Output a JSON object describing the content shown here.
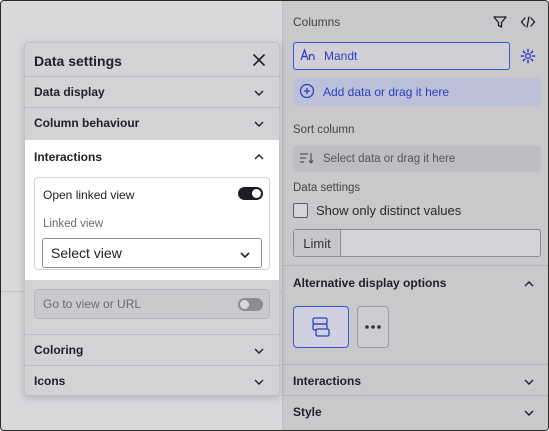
{
  "right_panel": {
    "columns_label": "Columns",
    "column_chip": "Mandt",
    "add_data": "Add data or drag it here",
    "sort_column_label": "Sort column",
    "sort_placeholder": "Select data or drag it here",
    "data_settings_label": "Data settings",
    "distinct_label": "Show only distinct values",
    "limit_label": "Limit",
    "limit_value": "",
    "alt_display_title": "Alternative display options",
    "interactions_title": "Interactions",
    "style_title": "Style"
  },
  "popup": {
    "title": "Data settings",
    "sections": {
      "data_display": "Data display",
      "column_behaviour": "Column behaviour",
      "interactions": "Interactions",
      "coloring": "Coloring",
      "icons": "Icons"
    },
    "open_linked_view": "Open linked view",
    "open_linked_view_on": true,
    "linked_view_label": "Linked view",
    "select_value": "Select view",
    "goto_label": "Go to view or URL",
    "goto_on": false
  },
  "icons": {
    "filter": "filter-icon",
    "code": "code-icon",
    "text_type": "text-type-icon",
    "gear": "gear-icon",
    "add": "plus-circle-icon",
    "sort": "sort-icon",
    "close": "close-icon",
    "chevron_down": "chevron-down-icon",
    "chevron_up": "chevron-up-icon"
  },
  "colors": {
    "accent": "#3b53d6",
    "toggle_on": "#1c1c28"
  }
}
